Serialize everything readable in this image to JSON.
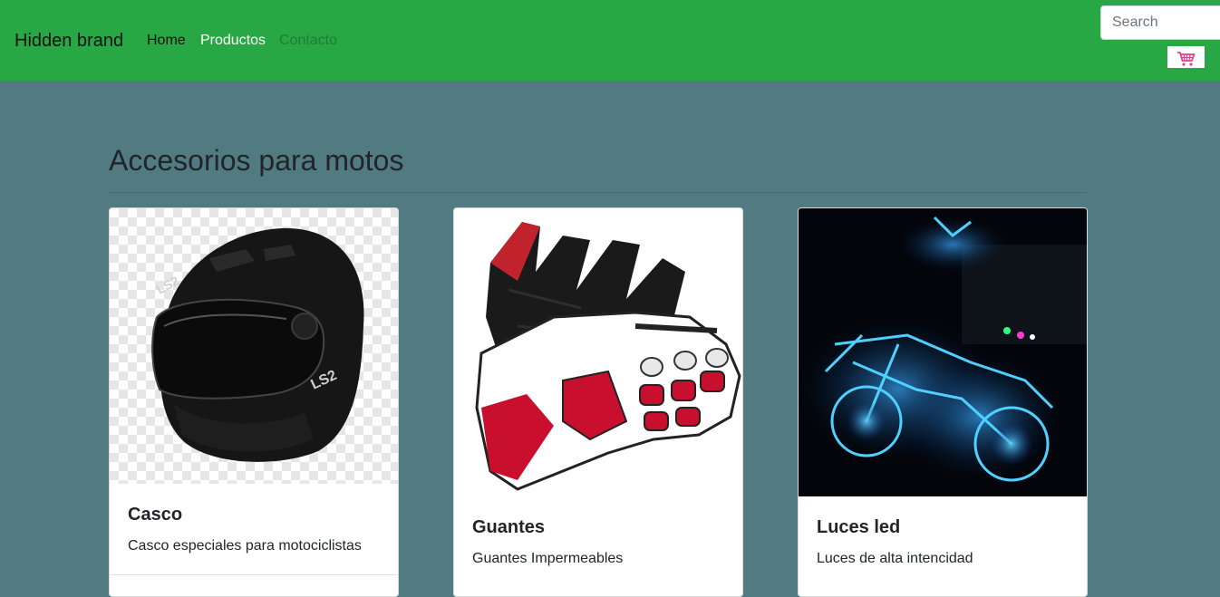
{
  "navbar": {
    "brand": "Hidden brand",
    "links": [
      {
        "label": "Home"
      },
      {
        "label": "Productos"
      },
      {
        "label": "Contacto"
      }
    ],
    "search": {
      "placeholder": "Search",
      "value": ""
    },
    "cart_icon": "shopping-cart-icon",
    "color": "#28a745"
  },
  "main": {
    "heading": "Accesorios para motos",
    "background": "#517b81",
    "cards": [
      {
        "title": "Casco",
        "text": "Casco especiales para motociclistas",
        "image": "motorcycle-helmet-image"
      },
      {
        "title": "Guantes",
        "text": "Guantes Impermeables",
        "image": "motorcycle-gloves-image"
      },
      {
        "title": "Luces led",
        "text": "Luces de alta intencidad",
        "image": "motorcycle-led-lights-image"
      }
    ]
  }
}
